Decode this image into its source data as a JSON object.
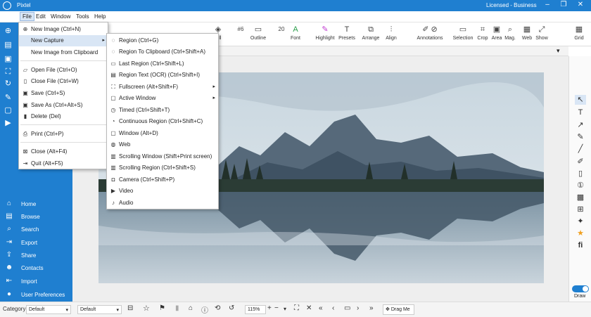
{
  "app": {
    "title": "Pixtel",
    "license": "Licensed - Business",
    "brand_color": "#1f7fd0"
  },
  "menubar": [
    "File",
    "Edit",
    "Window",
    "Tools",
    "Help"
  ],
  "file_menu": [
    {
      "icon": "plus-icon",
      "label": "New Image (Ctrl+N)"
    },
    {
      "icon": "",
      "label": "New Capture"
    },
    {
      "icon": "",
      "label": "New Image from Clipboard"
    },
    {
      "icon": "folder-open-icon",
      "label": "Open File (Ctrl+O)"
    },
    {
      "icon": "close-file-icon",
      "label": "Close File (Ctrl+W)"
    },
    {
      "icon": "save-icon",
      "label": "Save (Ctrl+S)"
    },
    {
      "icon": "save-as-icon",
      "label": "Save As (Ctrl+Alt+S)"
    },
    {
      "icon": "trash-icon",
      "label": "Delete (Del)"
    },
    {
      "icon": "printer-icon",
      "label": "Print (Ctrl+P)"
    },
    {
      "icon": "close-box-icon",
      "label": "Close (Alt+F4)"
    },
    {
      "icon": "quit-icon",
      "label": "Quit (Alt+F5)"
    }
  ],
  "capture_menu": [
    {
      "icon": "region-icon",
      "label": "Region (Ctrl+G)"
    },
    {
      "icon": "region-clipboard-icon",
      "label": "Region To Clipboard (Ctrl+Shift+A)"
    },
    {
      "icon": "last-region-icon",
      "label": "Last Region (Ctrl+Shift+L)"
    },
    {
      "icon": "ocr-icon",
      "label": "Region Text (OCR) (Ctrl+Shift+I)"
    },
    {
      "icon": "fullscreen-icon",
      "label": "Fullscreen (Alt+Shift+F)"
    },
    {
      "icon": "window-icon",
      "label": "Active Window"
    },
    {
      "icon": "timer-icon",
      "label": "Timed (Ctrl+Shift+T)"
    },
    {
      "icon": "continuous-region-icon",
      "label": "Continuous Region (Ctrl+Shift+C)"
    },
    {
      "icon": "window-icon",
      "label": "Window (Alt+D)"
    },
    {
      "icon": "globe-icon",
      "label": "Web"
    },
    {
      "icon": "scrolling-window-icon",
      "label": "Scrolling Window (Shift+Print screen)"
    },
    {
      "icon": "scrolling-region-icon",
      "label": "Scrolling Region (Ctrl+Shift+S)"
    },
    {
      "icon": "camera-icon",
      "label": "Camera (Ctrl+Shift+P)"
    },
    {
      "icon": "video-icon",
      "label": "Video"
    },
    {
      "icon": "audio-icon",
      "label": "Audio"
    }
  ],
  "sidebar_nav": [
    {
      "icon": "home-icon",
      "label": "Home"
    },
    {
      "icon": "browse-icon",
      "label": "Browse"
    },
    {
      "icon": "search-icon",
      "label": "Search"
    },
    {
      "icon": "export-icon",
      "label": "Export"
    },
    {
      "icon": "share-icon",
      "label": "Share"
    },
    {
      "icon": "contacts-icon",
      "label": "Contacts"
    },
    {
      "icon": "import-icon",
      "label": "Import"
    },
    {
      "icon": "user-icon",
      "label": "User Preferences"
    }
  ],
  "toolbar": {
    "fill_label": "Fill",
    "outline_label": "Outline",
    "width_value": "#6",
    "size_value": "20",
    "font_label": "Font",
    "highlight_label": "Highlight",
    "presets_label": "Presets",
    "arrange_label": "Arrange",
    "align_label": "Align",
    "annotations_label": "Annotations",
    "selection_label": "Selection",
    "crop_label": "Crop",
    "area_label": "Area",
    "mag_label": "Mag.",
    "web_label": "Web",
    "show_label": "Show",
    "grid_label": "Grid"
  },
  "right_tools": {
    "draw_label": "Draw"
  },
  "bottom": {
    "category_label": "Category",
    "category_value": "Default",
    "default_value": "Default",
    "zoom": "115%",
    "drag_label": "Drag Me"
  }
}
